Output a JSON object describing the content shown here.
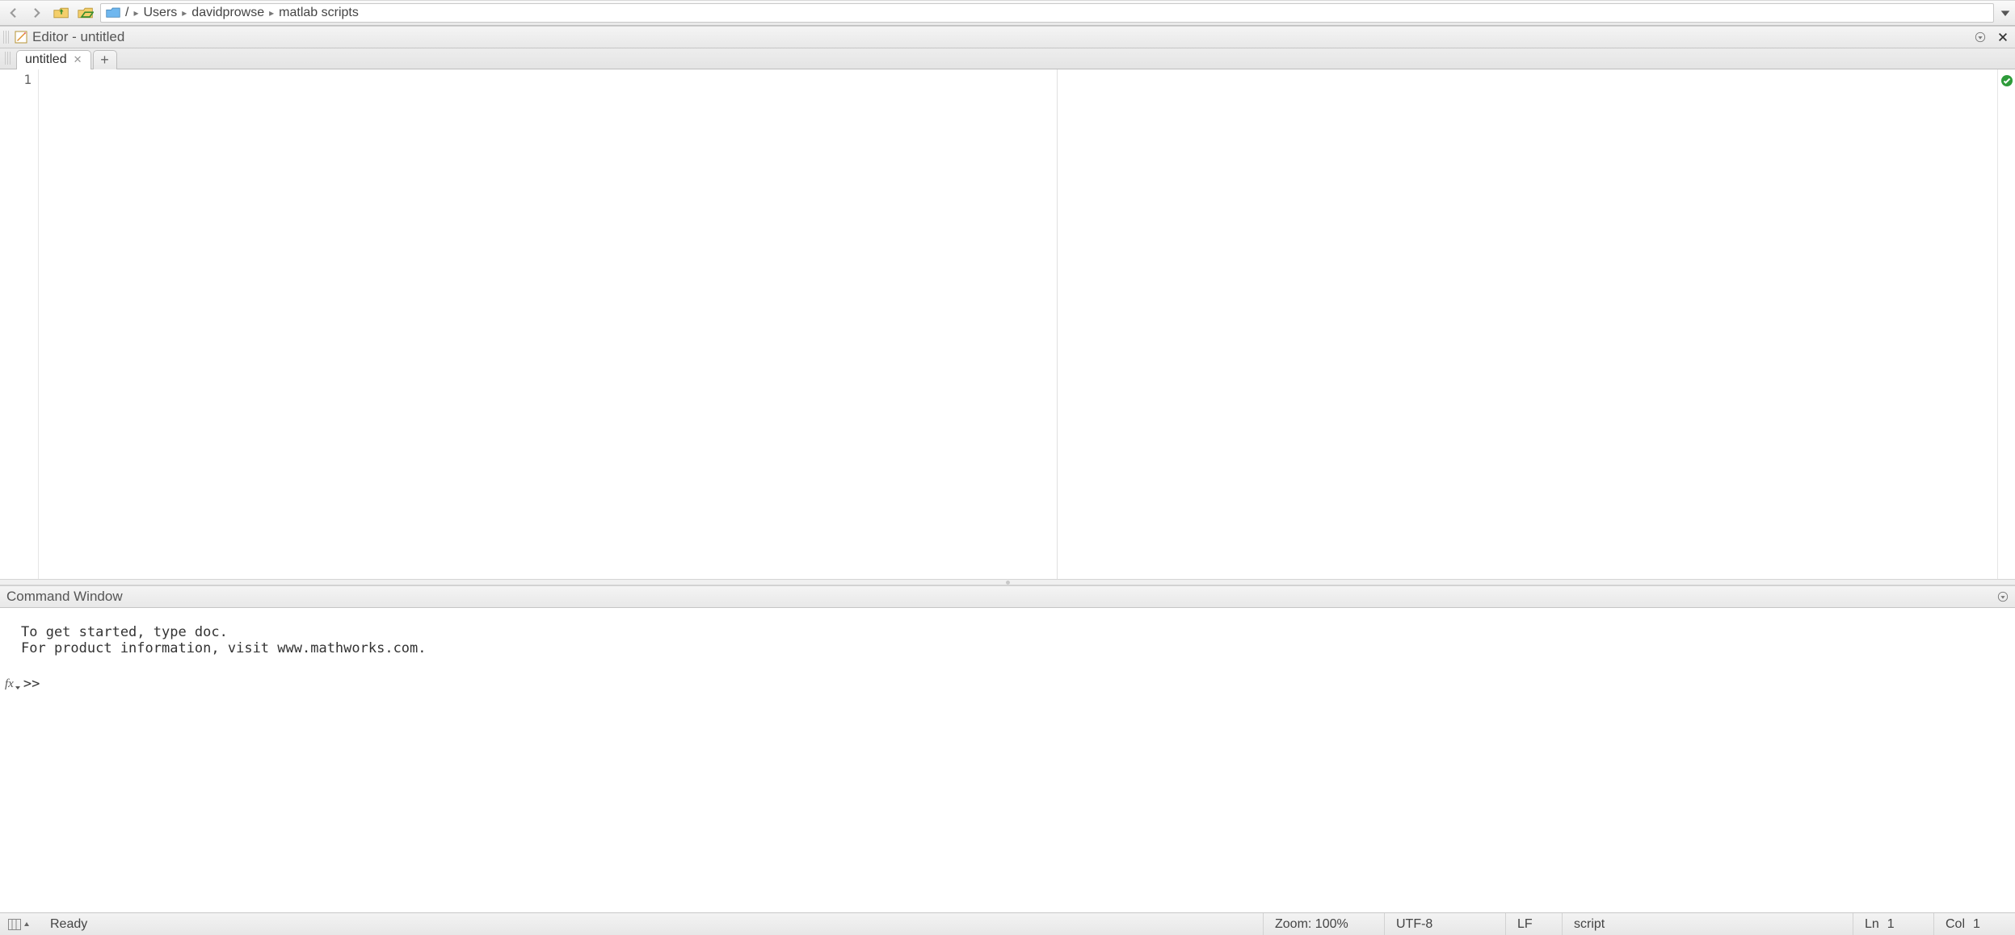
{
  "path": {
    "root": "/",
    "segments": [
      "Users",
      "davidprowse",
      "matlab scripts"
    ]
  },
  "editor": {
    "title": "Editor - untitled",
    "tabs": [
      {
        "label": "untitled",
        "active": true
      }
    ],
    "add_tab_label": "+",
    "line_numbers": [
      "1"
    ]
  },
  "command": {
    "title": "Command Window",
    "messages": [
      "To get started, type doc.",
      "For product information, visit www.mathworks.com."
    ],
    "prompt": ">>"
  },
  "status": {
    "ready": "Ready",
    "zoom_label": "Zoom:",
    "zoom_value": "100%",
    "encoding": "UTF-8",
    "line_ending": "LF",
    "file_type": "script",
    "ln_label": "Ln",
    "ln_value": "1",
    "col_label": "Col",
    "col_value": "1"
  }
}
